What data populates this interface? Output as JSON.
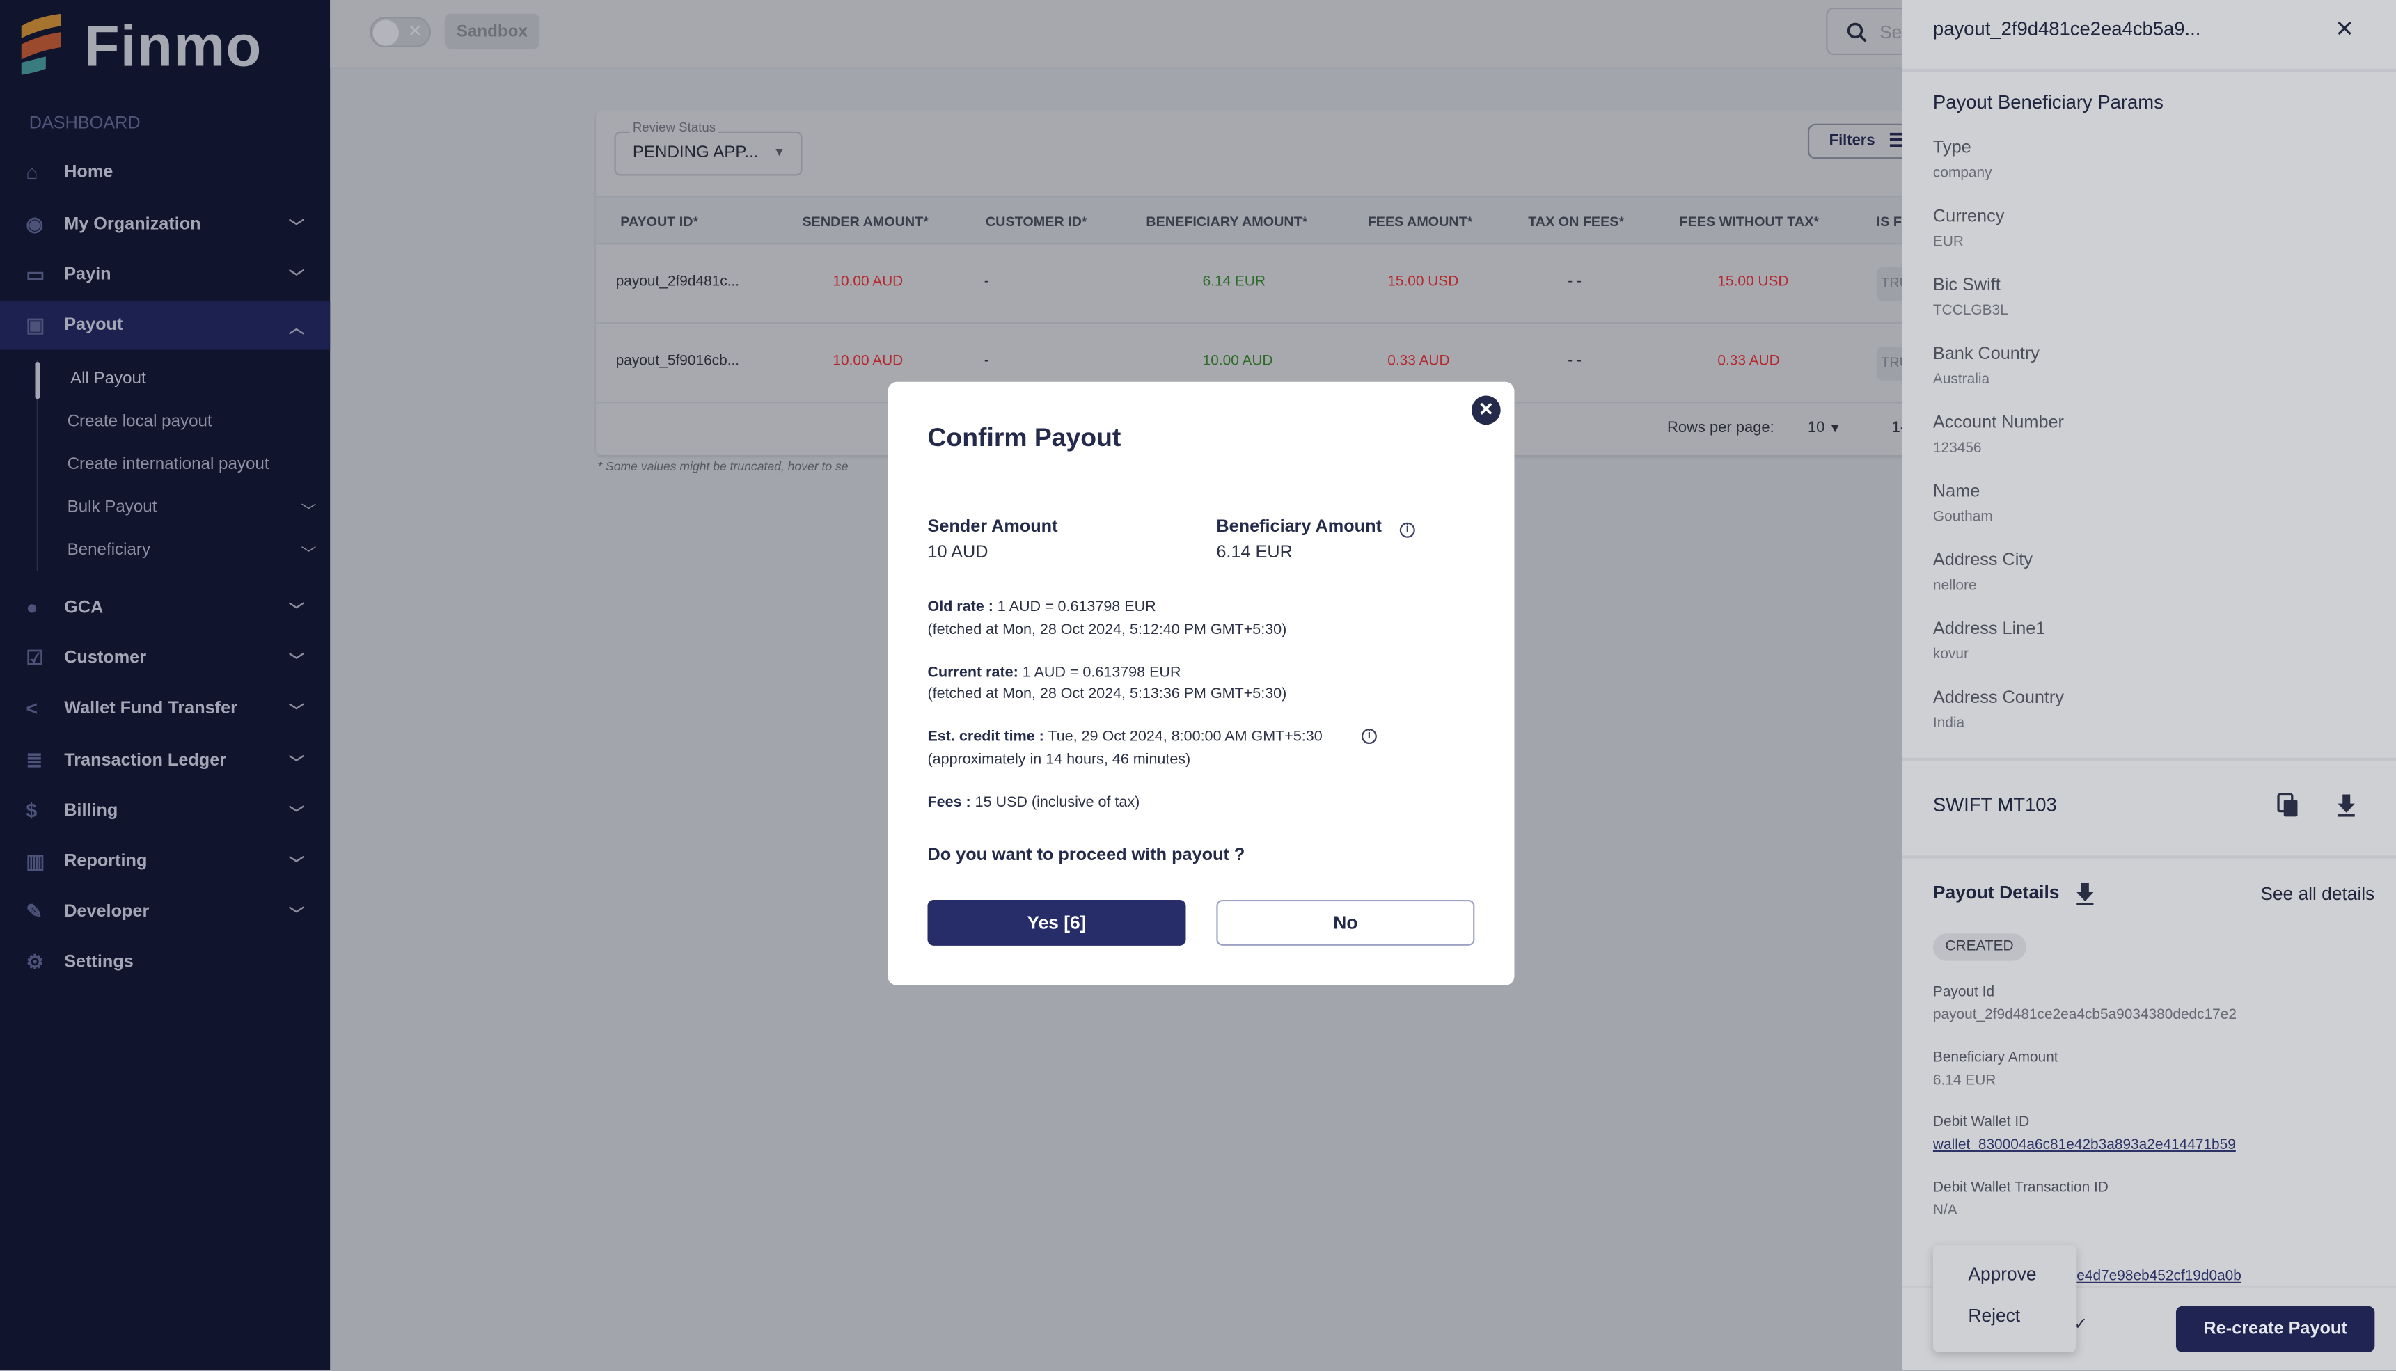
{
  "app": {
    "brand": "Finmo",
    "section_label": "DASHBOARD"
  },
  "sidebar": {
    "items": [
      {
        "label": "Home",
        "icon": "home-icon",
        "expandable": false
      },
      {
        "label": "My Organization",
        "icon": "user-circle-icon",
        "expandable": true
      },
      {
        "label": "Payin",
        "icon": "card-icon",
        "expandable": true
      },
      {
        "label": "Payout",
        "icon": "payout-icon",
        "expandable": true,
        "active": true
      },
      {
        "label": "GCA",
        "icon": "globe-icon",
        "expandable": true
      },
      {
        "label": "Customer",
        "icon": "customer-check-icon",
        "expandable": true
      },
      {
        "label": "Wallet Fund Transfer",
        "icon": "share-icon",
        "expandable": true
      },
      {
        "label": "Transaction Ledger",
        "icon": "ledger-icon",
        "expandable": true
      },
      {
        "label": "Billing",
        "icon": "dollar-icon",
        "expandable": true
      },
      {
        "label": "Reporting",
        "icon": "chart-icon",
        "expandable": true
      },
      {
        "label": "Developer",
        "icon": "wrench-icon",
        "expandable": true
      },
      {
        "label": "Settings",
        "icon": "gear-icon",
        "expandable": false
      }
    ],
    "payout_sub": [
      {
        "label": "All Payout",
        "current": true
      },
      {
        "label": "Create local payout"
      },
      {
        "label": "Create international payout"
      },
      {
        "label": "Bulk Payout",
        "expandable": true
      },
      {
        "label": "Beneficiary",
        "expandable": true
      }
    ]
  },
  "topbar": {
    "sandbox_label": "Sandbox",
    "search_placeholder": "Se"
  },
  "table": {
    "review_status_label": "Review Status",
    "review_status_value": "PENDING APP...",
    "filters_label": "Filters",
    "columns": [
      "PAYOUT ID*",
      "SENDER AMOUNT*",
      "CUSTOMER ID*",
      "BENEFICIARY AMOUNT*",
      "FEES AMOUNT*",
      "TAX ON FEES*",
      "FEES WITHOUT TAX*",
      "IS F"
    ],
    "rows": [
      [
        "payout_2f9d481c...",
        "10.00 AUD",
        "-",
        "6.14 EUR",
        "15.00 USD",
        "- -",
        "15.00 USD",
        "TRU"
      ],
      [
        "payout_5f9016cb...",
        "10.00 AUD",
        "-",
        "10.00 AUD",
        "0.33 AUD",
        "- -",
        "0.33 AUD",
        "TRU"
      ]
    ],
    "rows_per_page_label": "Rows per page:",
    "rows_per_page": "10",
    "range": "1-",
    "note": "* Some values might be truncated, hover to se"
  },
  "modal": {
    "title": "Confirm Payout",
    "sender_label": "Sender Amount",
    "sender_value": "10 AUD",
    "beneficiary_label": "Beneficiary Amount",
    "beneficiary_value": "6.14 EUR",
    "old_rate_label": "Old rate :",
    "old_rate": " 1 AUD = 0.613798 EUR",
    "old_rate_fetched": "(fetched at Mon, 28 Oct 2024, 5:12:40 PM GMT+5:30)",
    "current_rate_label": "Current rate:",
    "current_rate": " 1 AUD = 0.613798 EUR",
    "current_rate_fetched": "(fetched at Mon, 28 Oct 2024, 5:13:36 PM GMT+5:30)",
    "credit_label": "Est. credit time :",
    "credit_time": " Tue, 29 Oct 2024, 8:00:00 AM GMT+5:30",
    "credit_approx": "(approximately in 14 hours, 46 minutes)",
    "fees_label": "Fees :",
    "fees": " 15 USD (inclusive of tax)",
    "question": "Do you want to proceed with payout ?",
    "yes_label": "Yes [6]",
    "no_label": "No"
  },
  "drawer": {
    "title": "payout_2f9d481ce2ea4cb5a9...",
    "params_title": "Payout Beneficiary Params",
    "params": [
      {
        "label": "Type",
        "value": "company"
      },
      {
        "label": "Currency",
        "value": "EUR"
      },
      {
        "label": "Bic Swift",
        "value": "TCCLGB3L"
      },
      {
        "label": "Bank Country",
        "value": "Australia"
      },
      {
        "label": "Account Number",
        "value": "123456"
      },
      {
        "label": "Name",
        "value": "Goutham"
      },
      {
        "label": "Address City",
        "value": "nellore"
      },
      {
        "label": "Address Line1",
        "value": "kovur"
      },
      {
        "label": "Address Country",
        "value": "India"
      }
    ],
    "swift_title": "SWIFT MT103",
    "details_title": "Payout Details",
    "see_all": "See all details",
    "status": "CREATED",
    "details": [
      {
        "label": "Payout Id",
        "value": "payout_2f9d481ce2ea4cb5a9034380dedc17e2"
      },
      {
        "label": "Beneficiary Amount",
        "value": "6.14 EUR"
      },
      {
        "label": "Debit Wallet ID",
        "value": "wallet_830004a6c81e42b3a893a2e414471b59",
        "link": true
      },
      {
        "label": "Debit Wallet Transaction ID",
        "value": "N/A"
      }
    ],
    "partial_link": "e4d7e98eb452cf19d0a0b",
    "menu": [
      "Approve",
      "Reject"
    ],
    "recreate_label": "Re-create Payout"
  }
}
